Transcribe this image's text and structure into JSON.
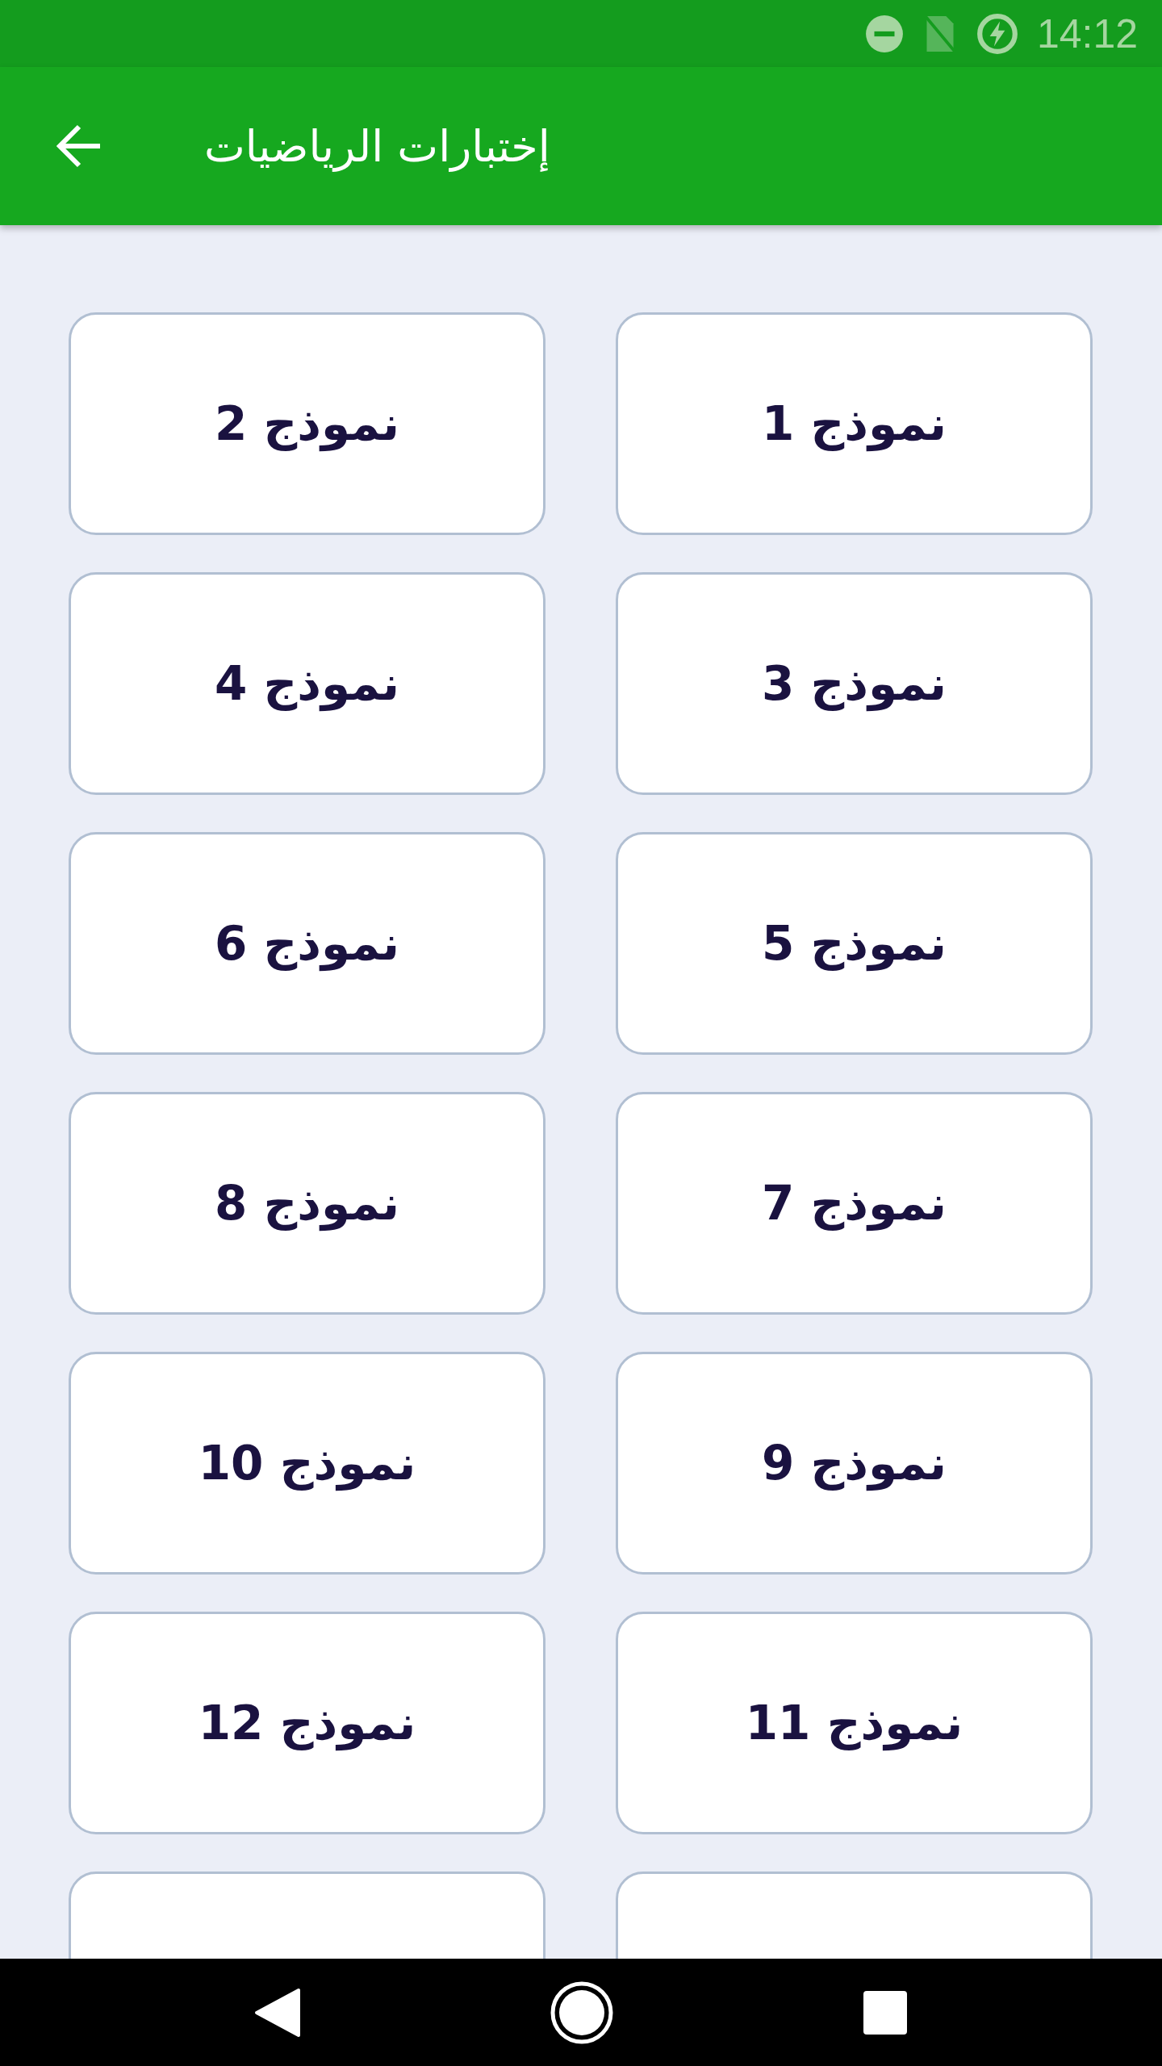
{
  "status_bar": {
    "time": "14:12"
  },
  "app_bar": {
    "title": "إختبارات الرياضيات"
  },
  "models": [
    {
      "label": "نموذج 1"
    },
    {
      "label": "نموذج 2"
    },
    {
      "label": "نموذج 3"
    },
    {
      "label": "نموذج 4"
    },
    {
      "label": "نموذج 5"
    },
    {
      "label": "نموذج 6"
    },
    {
      "label": "نموذج 7"
    },
    {
      "label": "نموذج 8"
    },
    {
      "label": "نموذج 9"
    },
    {
      "label": "نموذج 10"
    },
    {
      "label": "نموذج 11"
    },
    {
      "label": "نموذج 12"
    }
  ]
}
